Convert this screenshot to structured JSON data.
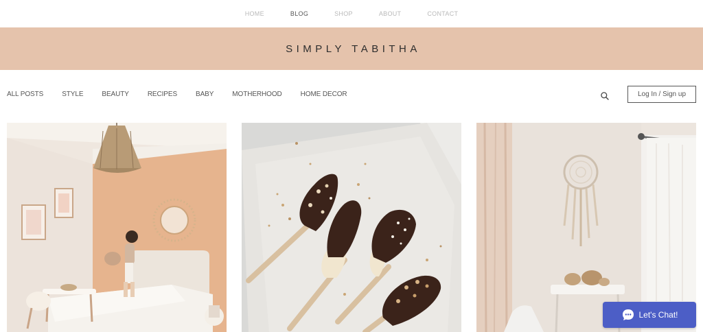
{
  "top_nav": {
    "items": [
      {
        "label": "HOME"
      },
      {
        "label": "BLOG",
        "active": true
      },
      {
        "label": "SHOP"
      },
      {
        "label": "ABOUT"
      },
      {
        "label": "CONTACT"
      }
    ]
  },
  "banner": {
    "title": "SIMPLY TABITHA",
    "background": "#e5c3ac"
  },
  "category_nav": {
    "items": [
      "ALL POSTS",
      "STYLE",
      "BEAUTY",
      "RECIPES",
      "BABY",
      "MOTHERHOOD",
      "HOME DECOR"
    ],
    "search_icon": "search-icon",
    "login_label": "Log In / Sign up"
  },
  "posts": [
    {
      "image": "nursery-bedroom-photo"
    },
    {
      "image": "chocolate-banana-pops-photo"
    },
    {
      "image": "dreamcatcher-room-photo"
    }
  ],
  "chat_widget": {
    "label": "Let's Chat!",
    "icon": "chat-bubble-icon",
    "color": "#4c5ec6"
  }
}
